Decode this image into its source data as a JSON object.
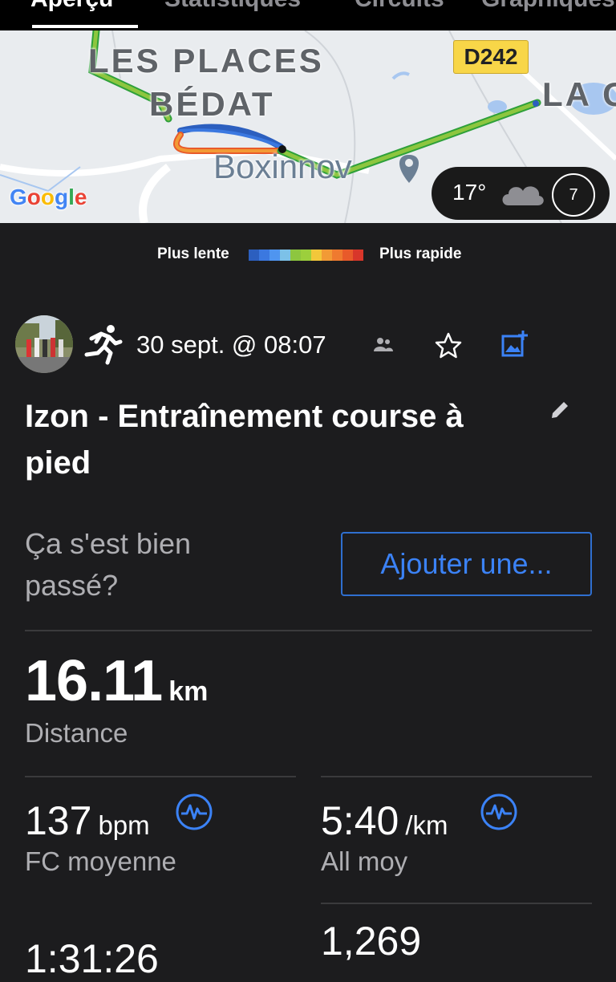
{
  "tabs": [
    {
      "label": "Aperçu",
      "active": true
    },
    {
      "label": "Statistiques",
      "active": false
    },
    {
      "label": "Circuits",
      "active": false
    },
    {
      "label": "Graphiques",
      "active": false
    }
  ],
  "map": {
    "labels": {
      "place_line1": "LES PLACES",
      "place_line2": "BÉDAT",
      "road": "D242",
      "town_partial": "LA C",
      "poi": "Boxinnov"
    },
    "google_logo": "Google",
    "weather": {
      "temperature": "17°",
      "condition_icon": "cloud-icon",
      "wind_speed": "7"
    }
  },
  "legend": {
    "slow_label": "Plus lente",
    "fast_label": "Plus rapide",
    "colors": [
      "#2c5fbf",
      "#3b78e0",
      "#4f95f0",
      "#7cc1e8",
      "#8dc63f",
      "#9ccf3c",
      "#f2c73a",
      "#f29a35",
      "#ef7a2f",
      "#e85a2a",
      "#d8362a"
    ]
  },
  "activity": {
    "date": "30 sept. @ 08:07",
    "title": "Izon - Entraînement course à pied",
    "feedback_question": "Ça s'est bien passé?",
    "add_button": "Ajouter une..."
  },
  "stats": {
    "distance": {
      "value": "16.11",
      "unit": "km",
      "label": "Distance"
    },
    "heart_rate": {
      "value": "137",
      "unit": "bpm",
      "label": "FC moyenne"
    },
    "pace": {
      "value": "5:40",
      "unit": "/km",
      "label": "All moy"
    },
    "time": {
      "value": "1:31:26"
    },
    "calories": {
      "value": "1,269"
    }
  },
  "colors": {
    "background": "#1c1c1e",
    "accent_blue": "#3b82f6",
    "muted_text": "#aeaeb2"
  }
}
